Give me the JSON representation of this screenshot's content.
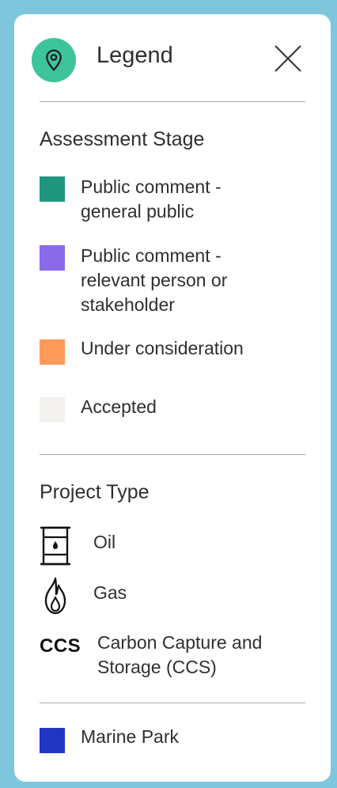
{
  "header": {
    "title": "Legend",
    "close_icon": "close-icon",
    "pin_icon": "map-pin-icon",
    "accent_color": "#3ec49b"
  },
  "assessment_stage": {
    "title": "Assessment Stage",
    "items": [
      {
        "label_line1": "Public comment -",
        "label_line2": "general public",
        "color": "#21967f"
      },
      {
        "label_line1": "Public comment -",
        "label_line2": "relevant person or",
        "label_line3": "stakeholder",
        "color": "#8b6ae8"
      },
      {
        "label": "Under consideration",
        "color": "#ff9a5a"
      },
      {
        "label": "Accepted",
        "color": "#f4f3ef"
      }
    ]
  },
  "project_type": {
    "title": "Project Type",
    "items": [
      {
        "label": "Oil",
        "icon": "oil-barrel-icon"
      },
      {
        "label": "Gas",
        "icon": "gas-flame-icon"
      },
      {
        "icon_text": "CCS",
        "label_line1": "Carbon Capture and",
        "label_line2": "Storage (CCS)"
      }
    ]
  },
  "other": {
    "items": [
      {
        "label": "Marine Park",
        "color": "#2336c2"
      }
    ]
  }
}
